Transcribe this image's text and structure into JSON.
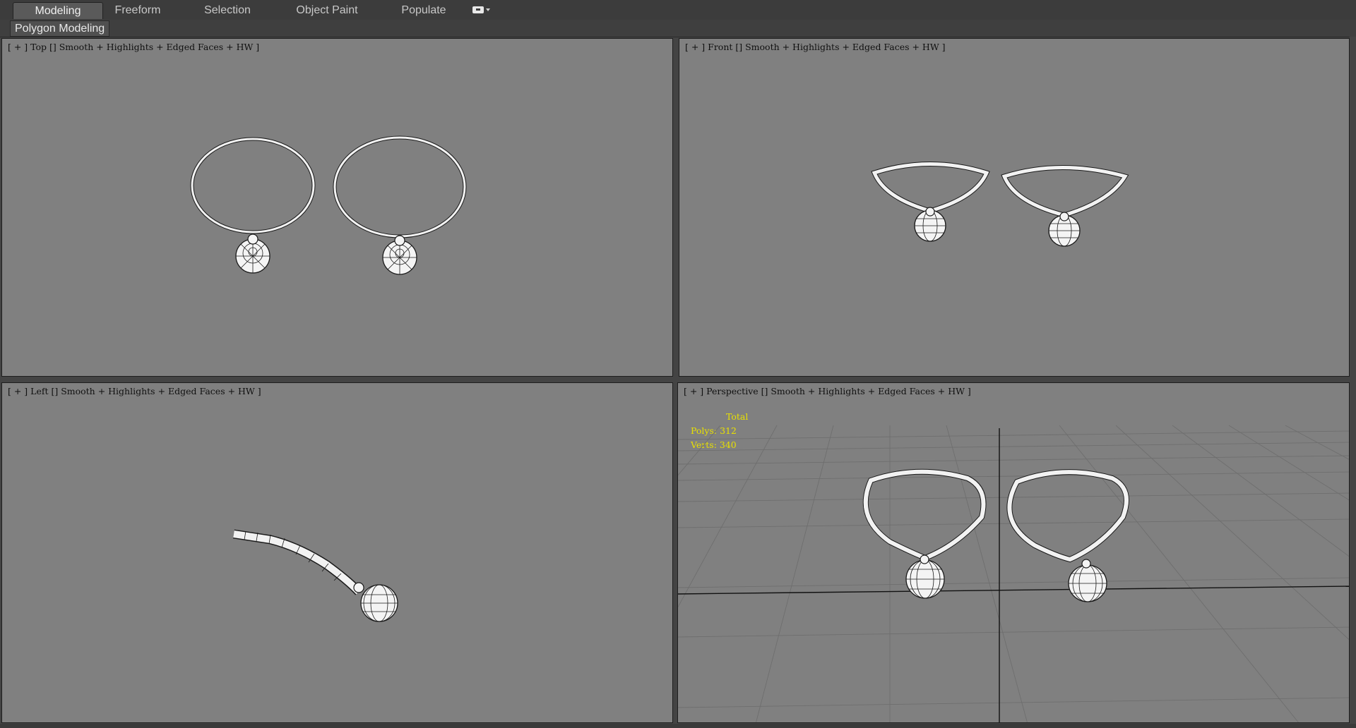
{
  "ribbon": {
    "tabs": [
      {
        "label": "Modeling",
        "active": true
      },
      {
        "label": "Freeform",
        "active": false
      },
      {
        "label": "Selection",
        "active": false
      },
      {
        "label": "Object Paint",
        "active": false
      },
      {
        "label": "Populate",
        "active": false
      }
    ],
    "extra_icon": "toggle-options-icon"
  },
  "subbar": {
    "panel_label": "Polygon Modeling"
  },
  "viewports": {
    "top": {
      "label": "[ + ] Top [] Smooth + Highlights + Edged Faces + HW ]"
    },
    "front": {
      "label": "[ + ] Front [] Smooth + Highlights + Edged Faces + HW ]"
    },
    "left": {
      "label": "[ + ] Left [] Smooth + Highlights + Edged Faces + HW ]"
    },
    "perspective": {
      "label": "[ + ] Perspective [] Smooth + Highlights + Edged Faces + HW ]",
      "stats": {
        "title": "Total",
        "polys": "Polys: 312",
        "verts": "Verts: 340"
      }
    }
  },
  "colors": {
    "viewport_bg": "#808080",
    "stats_text": "#e8e000",
    "wire": "#1a1a1a",
    "mesh_fill": "#f4f4f4"
  }
}
